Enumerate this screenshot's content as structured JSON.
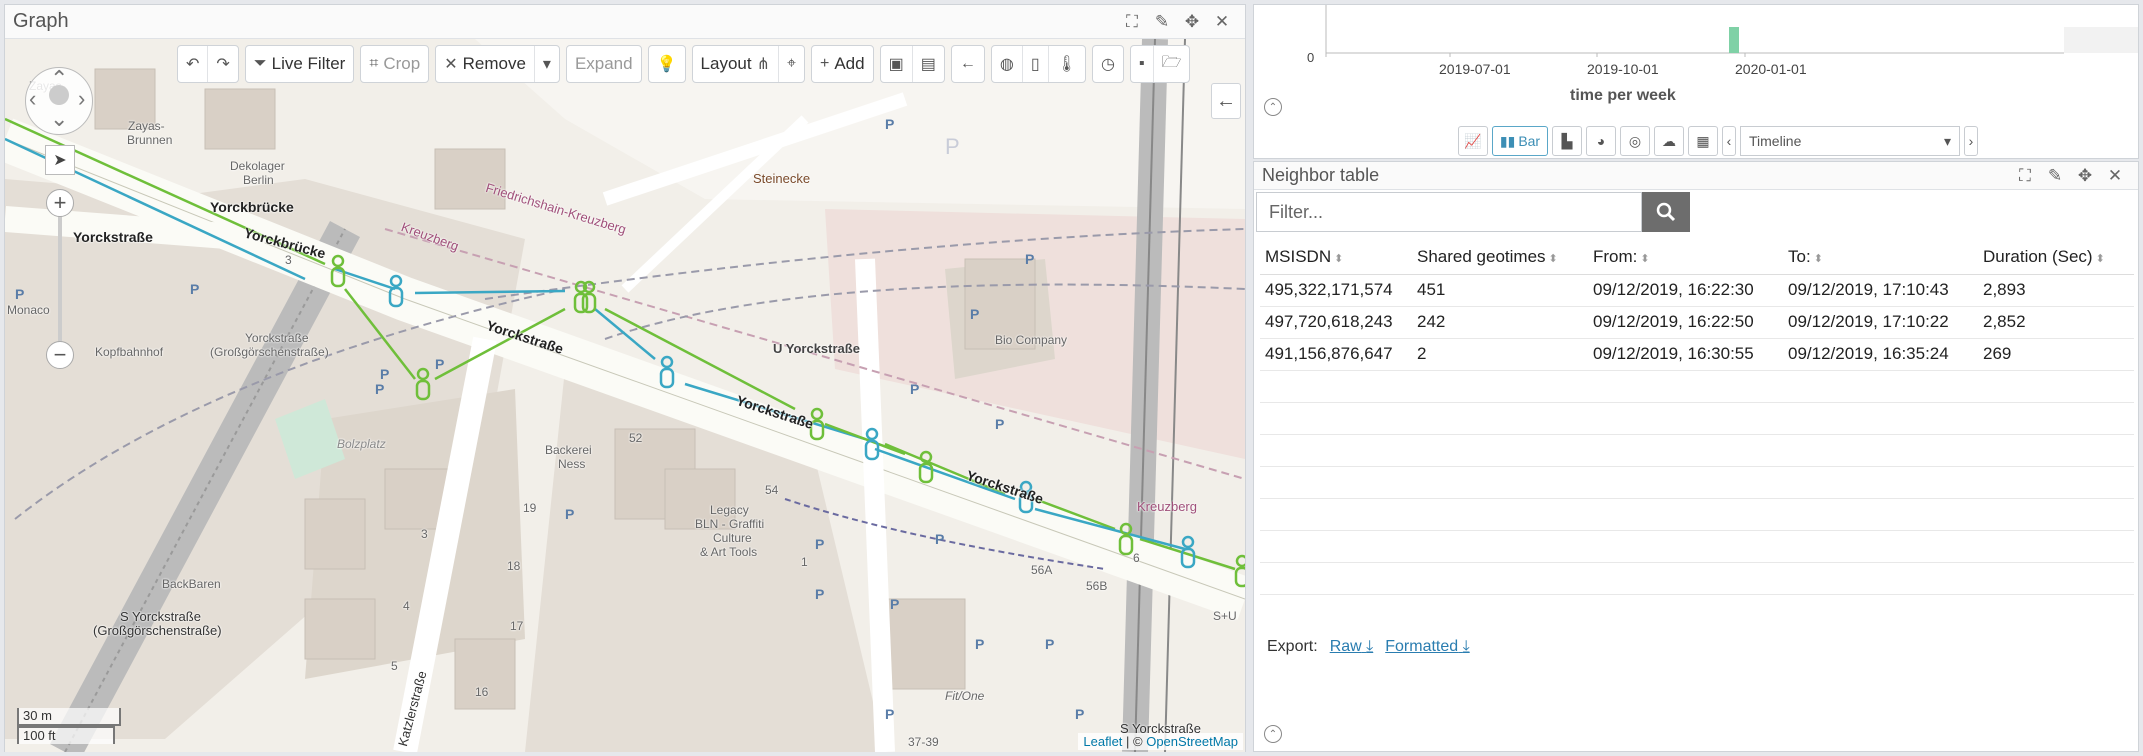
{
  "graph": {
    "title": "Graph",
    "toolbar": {
      "live_filter": "Live Filter",
      "crop": "Crop",
      "remove": "Remove",
      "expand": "Expand",
      "layout": "Layout",
      "add": "Add"
    },
    "scale": {
      "metric": "30 m",
      "imperial": "100 ft"
    },
    "attribution": {
      "leaflet": "Leaflet",
      "separator": " | © ",
      "osm": "OpenStreetMap"
    },
    "map_labels": {
      "yorckbrucke_1": "Yorckbrücke",
      "yorckbrucke_2": "Yorckbrücke",
      "yorckstrasse_1": "Yorckstraße",
      "yorckstrasse_2": "Yorckstraße",
      "yorckstrasse_3": "Yorckstraße",
      "yorckstrasse_4": "Yorckstraße",
      "yorckstrasse_gross_1": "Yorckstraße",
      "gross_1": "(Großgörschenstraße)",
      "yorckstrasse_gross_2": "S Yorckstraße",
      "gross_2": "(Großgörschenstraße)",
      "zayas": "Zayas-",
      "brunnen": "Brunnen",
      "dekolager": "Dekolager",
      "berlin": "Berlin",
      "kreuzberg_1": "Kreuzberg",
      "friedrichshain": "Friedrichshain-Kreuzberg",
      "steinecke": "Steinecke",
      "u_yorck": "U Yorckstraße",
      "bio_company": "Bio Company",
      "kopfbahnhof": "Kopfbahnhof",
      "bolzplatz": "Bolzplatz",
      "backerei": "Backerei",
      "ness": "Ness",
      "legacy": "Legacy",
      "bln_graffiti": "BLN - Graffiti",
      "culture": "Culture",
      "art_tools": "& Art Tools",
      "backbaren": "BackBaren",
      "monaco": "Monaco",
      "fit_one": "Fit/One",
      "s_yorck": "S Yorckstraße",
      "katzlerstrasse": "Katzlerstraße",
      "kreuzberg_2": "Kreuzberg",
      "n52": "52",
      "n54": "54",
      "n19": "19",
      "n18": "18",
      "n17": "17",
      "n16": "16",
      "n1": "1",
      "n3": "3",
      "n4": "4",
      "n5": "5",
      "n56a": "56A",
      "n56b": "56B",
      "n3739": "37-39",
      "n3b": "3",
      "n6": "6",
      "su": "S+U"
    }
  },
  "chart": {
    "axis_zero": "0",
    "ticks": [
      "2019-07-01",
      "2019-10-01",
      "2020-01-01"
    ],
    "xlabel": "time per week",
    "bar_label": "Bar",
    "timeline_select": "Timeline"
  },
  "neighbor": {
    "title": "Neighbor table",
    "filter_placeholder": "Filter...",
    "columns": [
      "MSISDN",
      "Shared geotimes",
      "From:",
      "To:",
      "Duration (Sec)"
    ],
    "rows": [
      [
        "495,322,171,574",
        "451",
        "09/12/2019, 16:22:30",
        "09/12/2019, 17:10:43",
        "2,893"
      ],
      [
        "497,720,618,243",
        "242",
        "09/12/2019, 16:22:50",
        "09/12/2019, 17:10:22",
        "2,852"
      ],
      [
        "491,156,876,647",
        "2",
        "09/12/2019, 16:30:55",
        "09/12/2019, 16:35:24",
        "269"
      ]
    ],
    "export_label": "Export:",
    "export_raw": "Raw",
    "export_formatted": "Formatted"
  },
  "colors": {
    "green_track": "#6fbf3a",
    "blue_track": "#3aa7c4",
    "accent": "#5aa7c8"
  },
  "icons": [
    "expand-icon",
    "edit-icon",
    "move-icon",
    "close-icon",
    "undo-icon",
    "redo-icon",
    "filter-icon",
    "crop-icon",
    "lightbulb-icon",
    "layout-icon",
    "globe-icon",
    "map-icon",
    "thermometer-icon",
    "clock-icon",
    "save-icon",
    "folder-open-icon",
    "search-icon",
    "download-icon"
  ]
}
